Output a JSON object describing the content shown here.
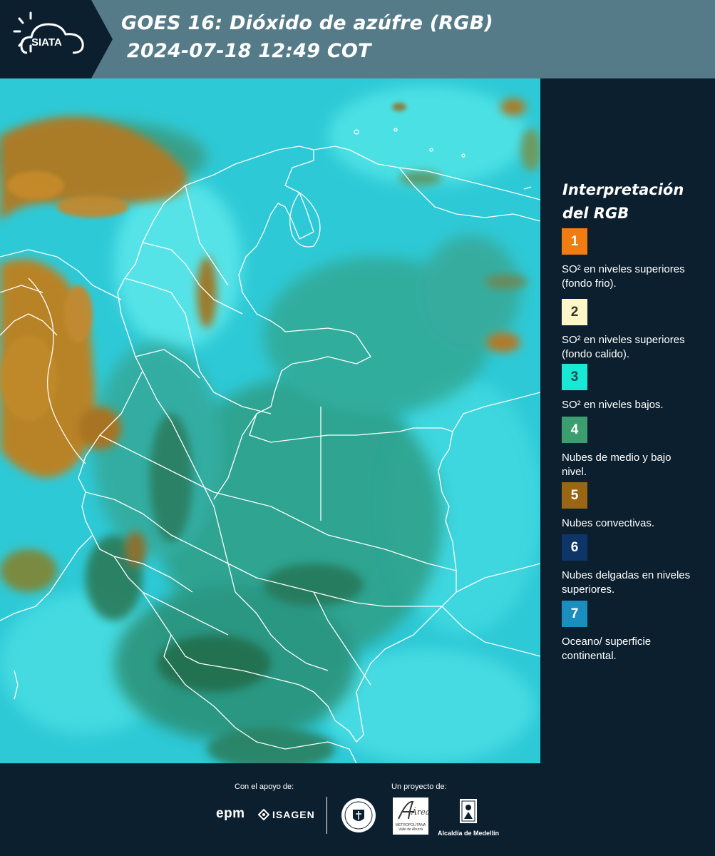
{
  "header": {
    "logo_text": "SIATA",
    "title_line1": "GOES 16: Dióxido de azúfre (RGB)",
    "title_line2": "2024-07-18 12:49 COT",
    "background_color": "#557b88",
    "logo_color": "#0b1f2e"
  },
  "legend": {
    "title": "Interpretación del RGB",
    "items": [
      {
        "number": "1",
        "label": "SO² en niveles superiores (fondo frio).",
        "color": "#f07c12",
        "text_color": "#ffffff"
      },
      {
        "number": "2",
        "label": "SO² en niveles superiores (fondo calido).",
        "color": "#fdf6c6",
        "text_color": "#333333"
      },
      {
        "number": "3",
        "label": "SO² en niveles bajos.",
        "color": "#18e8d4",
        "text_color": "#1a4a50"
      },
      {
        "number": "4",
        "label": "Nubes de medio y bajo nivel.",
        "color": "#3c9e6f",
        "text_color": "#ffffff"
      },
      {
        "number": "5",
        "label": "Nubes convectivas.",
        "color": "#9a6614",
        "text_color": "#ffffff"
      },
      {
        "number": "6",
        "label": "Nubes delgadas en niveles superiores.",
        "color": "#0d3568",
        "text_color": "#ffffff"
      },
      {
        "number": "7",
        "label": "Oceano/ superficie continental.",
        "color": "#1a8fbf",
        "text_color": "#ffffff"
      }
    ]
  },
  "footer": {
    "support_caption": "Con el apoyo de:",
    "project_caption": "Un proyecto de:",
    "epm_text": "epm",
    "isagen_text": "ISAGEN",
    "area_text": "Área",
    "area_subtext": "METROPOLITANA Valle de Aburrá",
    "alcaldia_text": "Alcaldía de Medellín"
  },
  "map": {
    "colors": {
      "ocean": "#2ec9d6",
      "land": "#35a8a0",
      "lowcloud": "#2e8f6a",
      "convective": "#a07020",
      "border": "#ffffff"
    }
  }
}
